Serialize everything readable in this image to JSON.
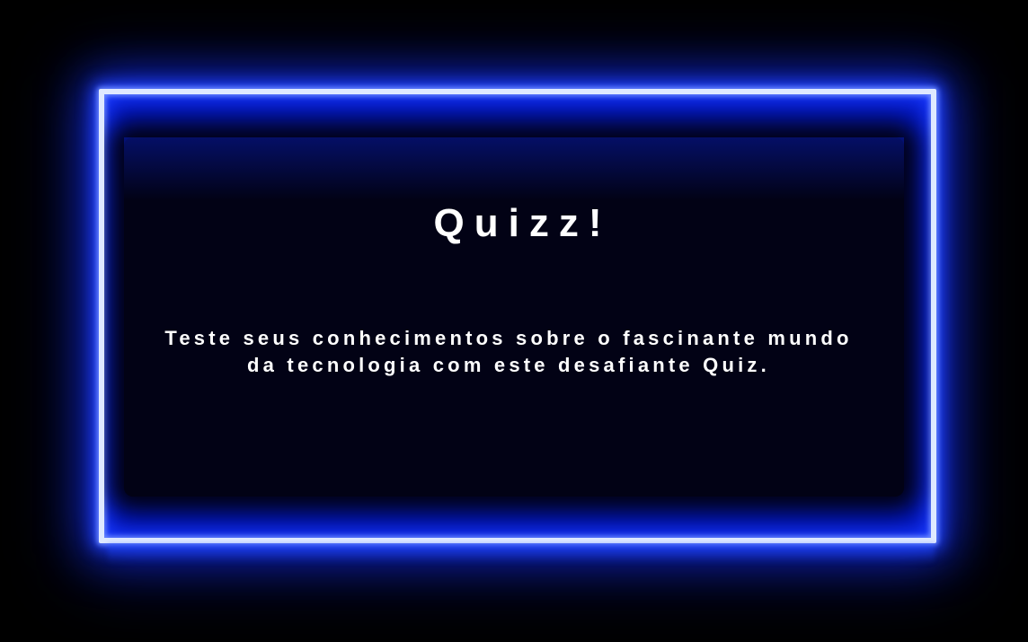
{
  "hero": {
    "title": "Quizz!",
    "description": "Teste seus conhecimentos sobre o fascinante mundo da tecnologia com este desafiante Quiz."
  },
  "colors": {
    "background": "#000000",
    "frame_border": "#dfe9ff",
    "neon_blue": "#0318c8",
    "glow": "#2244ff",
    "panel": "#020215",
    "text": "#ffffff"
  }
}
